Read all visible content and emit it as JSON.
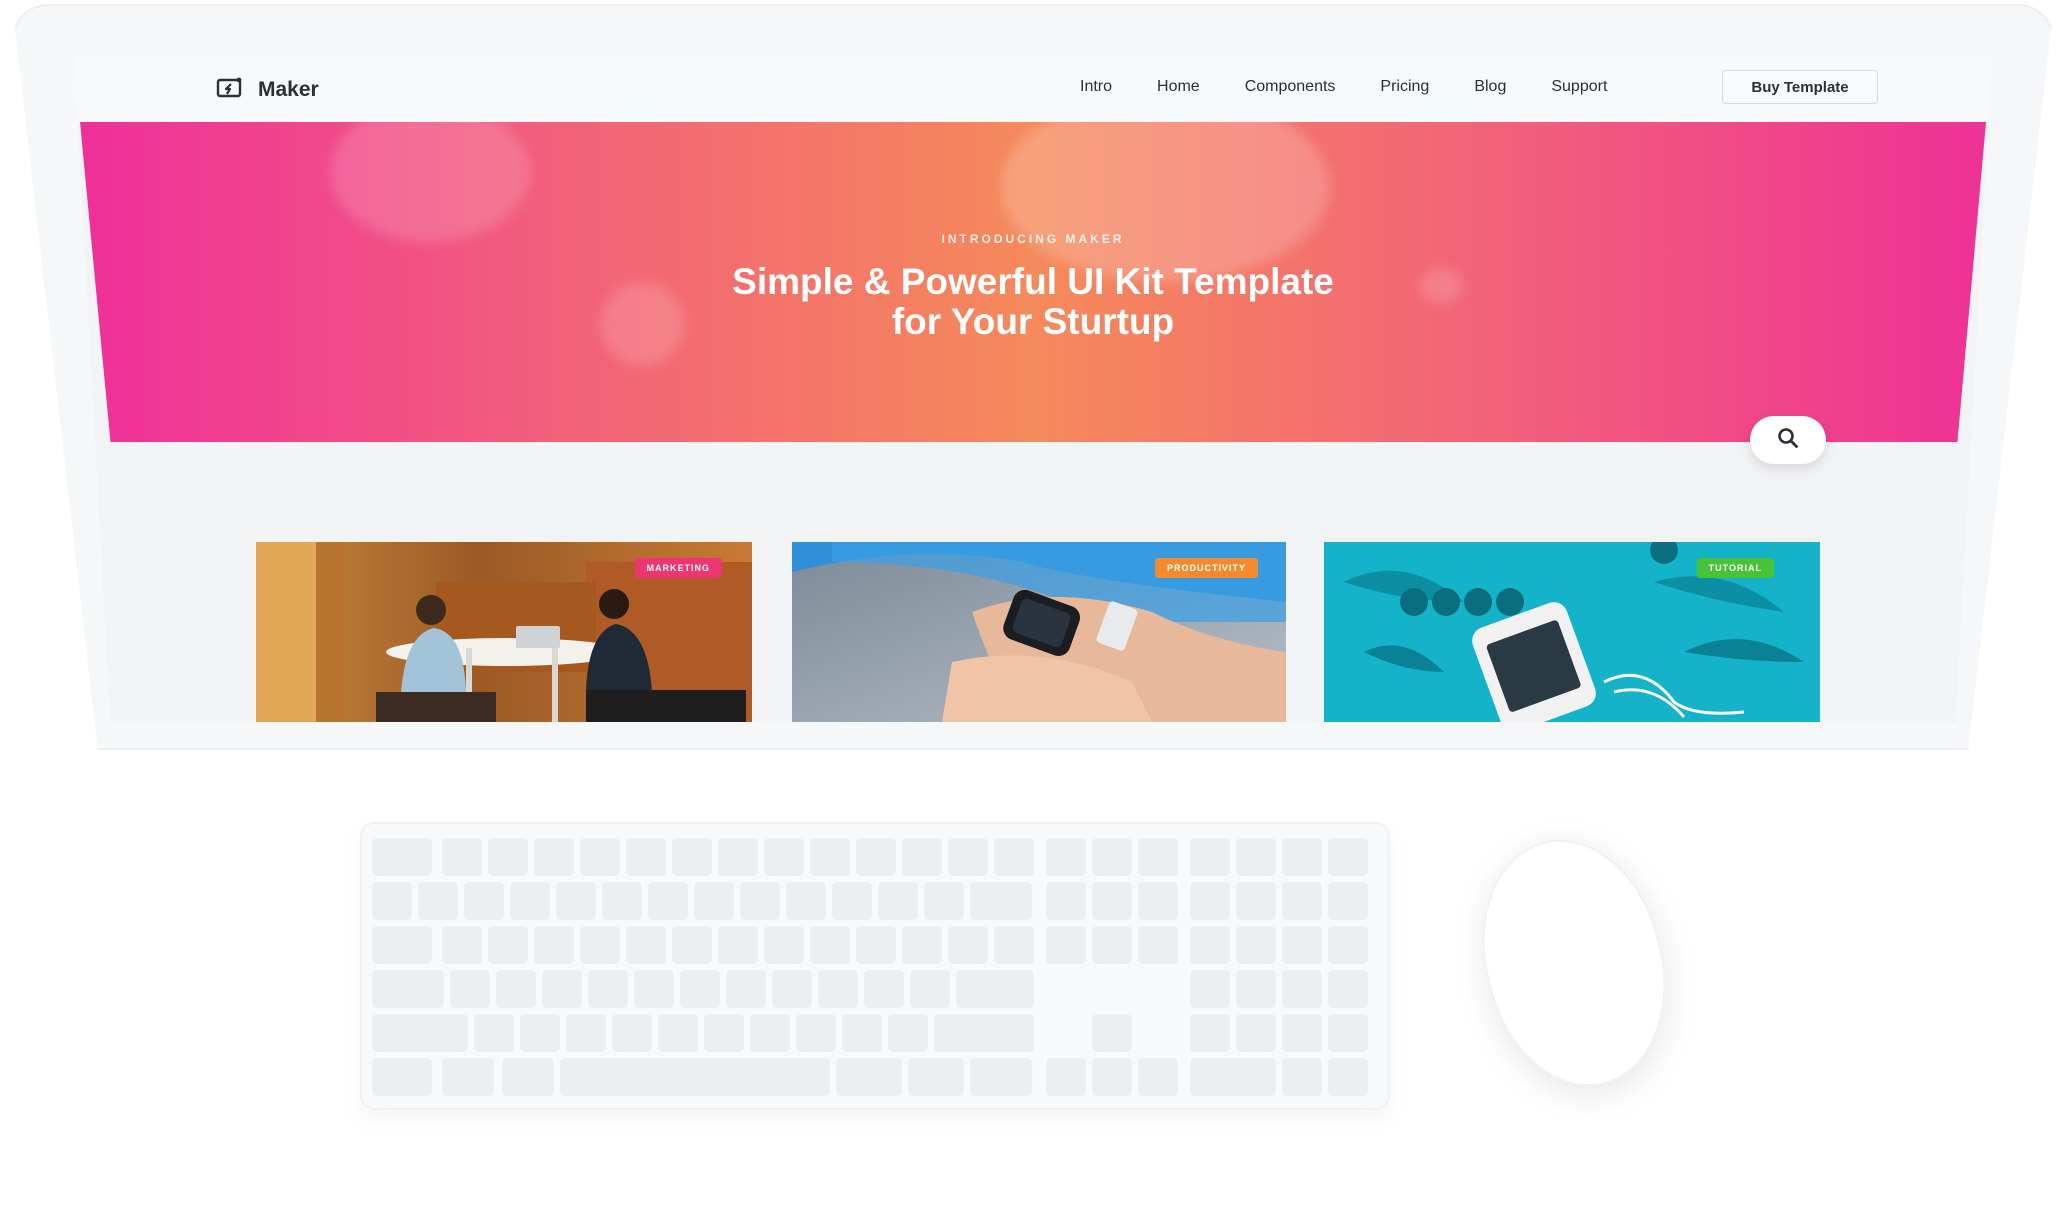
{
  "brand": {
    "name": "Maker",
    "icon": "maker-logo-icon"
  },
  "nav": {
    "items": [
      "Intro",
      "Home",
      "Components",
      "Pricing",
      "Blog",
      "Support"
    ],
    "cta": "Buy Template"
  },
  "hero": {
    "eyebrow": "INTRODUCING MAKER",
    "title_line1": "Simple & Powerful UI Kit Template",
    "title_line2": "for Your Sturtup",
    "gradient": [
      "#ef2f9a",
      "#f58a5a",
      "#ee3196"
    ]
  },
  "search": {
    "icon": "search-icon"
  },
  "cards": [
    {
      "badge": "MARKETING",
      "badge_color": "#ef3472"
    },
    {
      "badge": "PRODUCTIVITY",
      "badge_color": "#f48a2e"
    },
    {
      "badge": "TUTORIAL",
      "badge_color": "#47c239"
    }
  ]
}
